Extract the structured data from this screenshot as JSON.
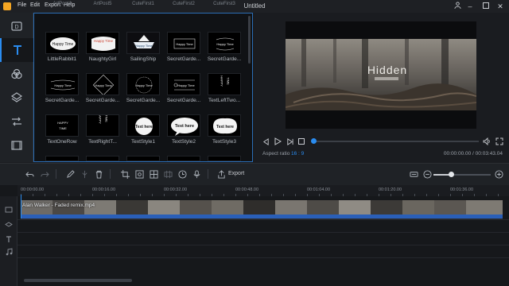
{
  "menubar": {
    "items": [
      "File",
      "Edit",
      "Export",
      "Help"
    ],
    "title": "Untitled"
  },
  "sidebar": {
    "items": [
      {
        "name": "media-icon"
      },
      {
        "name": "text-icon"
      },
      {
        "name": "filter-icon"
      },
      {
        "name": "overlay-icon"
      },
      {
        "name": "transition-icon"
      },
      {
        "name": "element-icon"
      }
    ],
    "active": "text-icon"
  },
  "library": {
    "top_row_labels": [
      "ArtPost4",
      "ArtPost5",
      "CuteFirst1",
      "CuteFirst2",
      "CuteFirst3"
    ],
    "rows": [
      [
        "LittleRabbit1",
        "NaughtyGirl",
        "SailingShip",
        "SecretGarde...",
        "SecretGarde..."
      ],
      [
        "SecretGarde...",
        "SecretGarde...",
        "SecretGarde...",
        "SecretGarde...",
        "TextLeftTwo..."
      ],
      [
        "TextOneRow",
        "TextRightT...",
        "TextStyle1",
        "TextStyle2",
        "TextStyle3"
      ]
    ],
    "tile_texts": {
      "happy_time": "Happy Time",
      "text_here": "Text here",
      "happy": "HAPPY",
      "time": "TIME"
    }
  },
  "preview": {
    "video_title_text": "Hidden",
    "aspect_label": "Aspect ratio",
    "aspect_value": "16 : 9",
    "time": "00:00:00.00 / 00:03:43.04",
    "progress": 0.0
  },
  "toolbar": {
    "export_label": "Export",
    "zoom_level": 0.3
  },
  "timeline": {
    "ticks": [
      "00:00:00.00",
      "00:00:16.00",
      "00:00:32.00",
      "00:00:48.00",
      "00:01:04.00",
      "00:01:20.00",
      "00:01:36.00"
    ],
    "clip_name": "Alan Walker - Faded remix.mp4"
  },
  "colors": {
    "accent": "#2a8cf0",
    "logo": "#f5a623",
    "audio_bar": "#2a5fb8"
  }
}
